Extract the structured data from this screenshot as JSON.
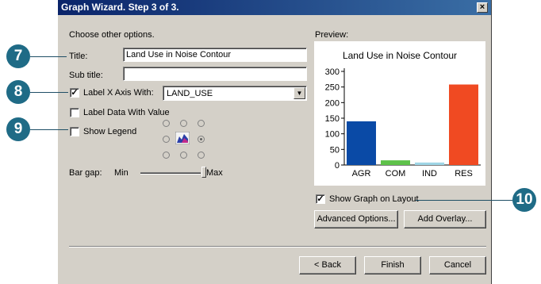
{
  "window": {
    "title": "Graph Wizard. Step 3 of 3.",
    "close_glyph": "×"
  },
  "instructions": "Choose other options.",
  "fields": {
    "title_label": "Title:",
    "title_value": "Land Use in Noise Contour",
    "subtitle_label": "Sub title:",
    "subtitle_value": ""
  },
  "options": {
    "label_x_axis": {
      "label": "Label X Axis With:",
      "checked": true,
      "check_glyph": "✓",
      "selected": "LAND_USE"
    },
    "label_data": {
      "label": "Label Data With Value",
      "checked": false
    },
    "show_legend": {
      "label": "Show Legend",
      "checked": false
    }
  },
  "bar_gap": {
    "label": "Bar gap:",
    "min_label": "Min",
    "max_label": "Max",
    "level": 0.1
  },
  "preview_label": "Preview:",
  "show_graph_layout": {
    "label": "Show Graph on Layout",
    "checked": true,
    "check_glyph": "✓"
  },
  "buttons": {
    "advanced": "Advanced Options...",
    "overlay": "Add Overlay...",
    "back": "< Back",
    "finish": "Finish",
    "cancel": "Cancel"
  },
  "callouts": [
    "7",
    "8",
    "9",
    "10"
  ],
  "colors": {
    "titlebar": "#0a246a",
    "callout": "#1f6b86"
  },
  "chart_data": {
    "type": "bar",
    "title": "Land Use in Noise Contour",
    "categories": [
      "AGR",
      "COM",
      "IND",
      "RES"
    ],
    "values": [
      140,
      15,
      8,
      258
    ],
    "colors": [
      "#0a4aa6",
      "#5ec24a",
      "#9fd6e6",
      "#f04a22"
    ],
    "yticks": [
      0,
      50,
      100,
      150,
      200,
      250,
      300
    ],
    "ylim": [
      0,
      300
    ],
    "grid": false
  }
}
